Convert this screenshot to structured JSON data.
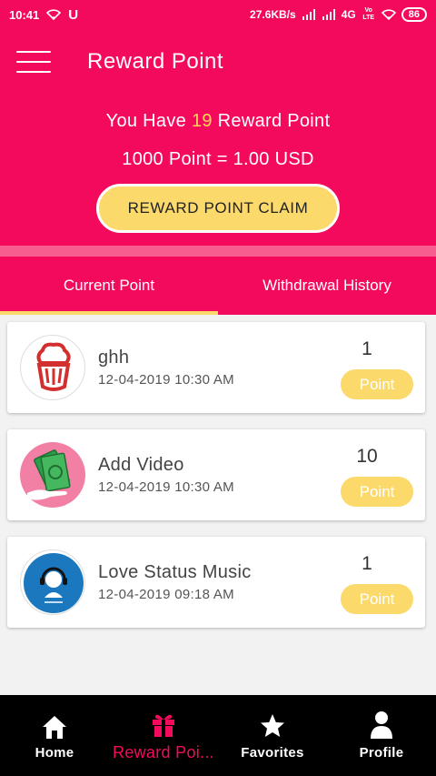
{
  "status_bar": {
    "time": "10:41",
    "carrier_icon": "U",
    "speed": "27.6KB/s",
    "network": "4G",
    "volte": "Vo LTE",
    "battery": "86"
  },
  "app_bar": {
    "menu_icon": "hamburger-icon",
    "title": "Reward Point"
  },
  "summary": {
    "prefix": "You Have ",
    "points": "19",
    "suffix": " Reward Point",
    "rate": "1000 Point = 1.00 USD",
    "claim_button": "REWARD POINT CLAIM"
  },
  "tabs": [
    {
      "label": "Current Point",
      "active": true
    },
    {
      "label": "Withdrawal History",
      "active": false
    }
  ],
  "entries": [
    {
      "name": "ghh",
      "date": "12-04-2019 10:30 AM",
      "points": "1",
      "badge": "Point",
      "icon": "cupcake-logo-icon"
    },
    {
      "name": "Add Video",
      "date": "12-04-2019 10:30 AM",
      "points": "10",
      "badge": "Point",
      "icon": "money-hand-icon"
    },
    {
      "name": "Love Status Music",
      "date": "12-04-2019 09:18 AM",
      "points": "1",
      "badge": "Point",
      "icon": "music-headphone-logo-icon"
    }
  ],
  "bottom_nav": [
    {
      "label": "Home",
      "icon": "home-icon",
      "active": false
    },
    {
      "label": "Reward Poi...",
      "icon": "gift-icon",
      "active": true
    },
    {
      "label": "Favorites",
      "icon": "star-icon",
      "active": false
    },
    {
      "label": "Profile",
      "icon": "person-icon",
      "active": false
    }
  ],
  "colors": {
    "primary": "#f40a5c",
    "accent": "#fbd96a",
    "nav_bg": "#000000"
  }
}
